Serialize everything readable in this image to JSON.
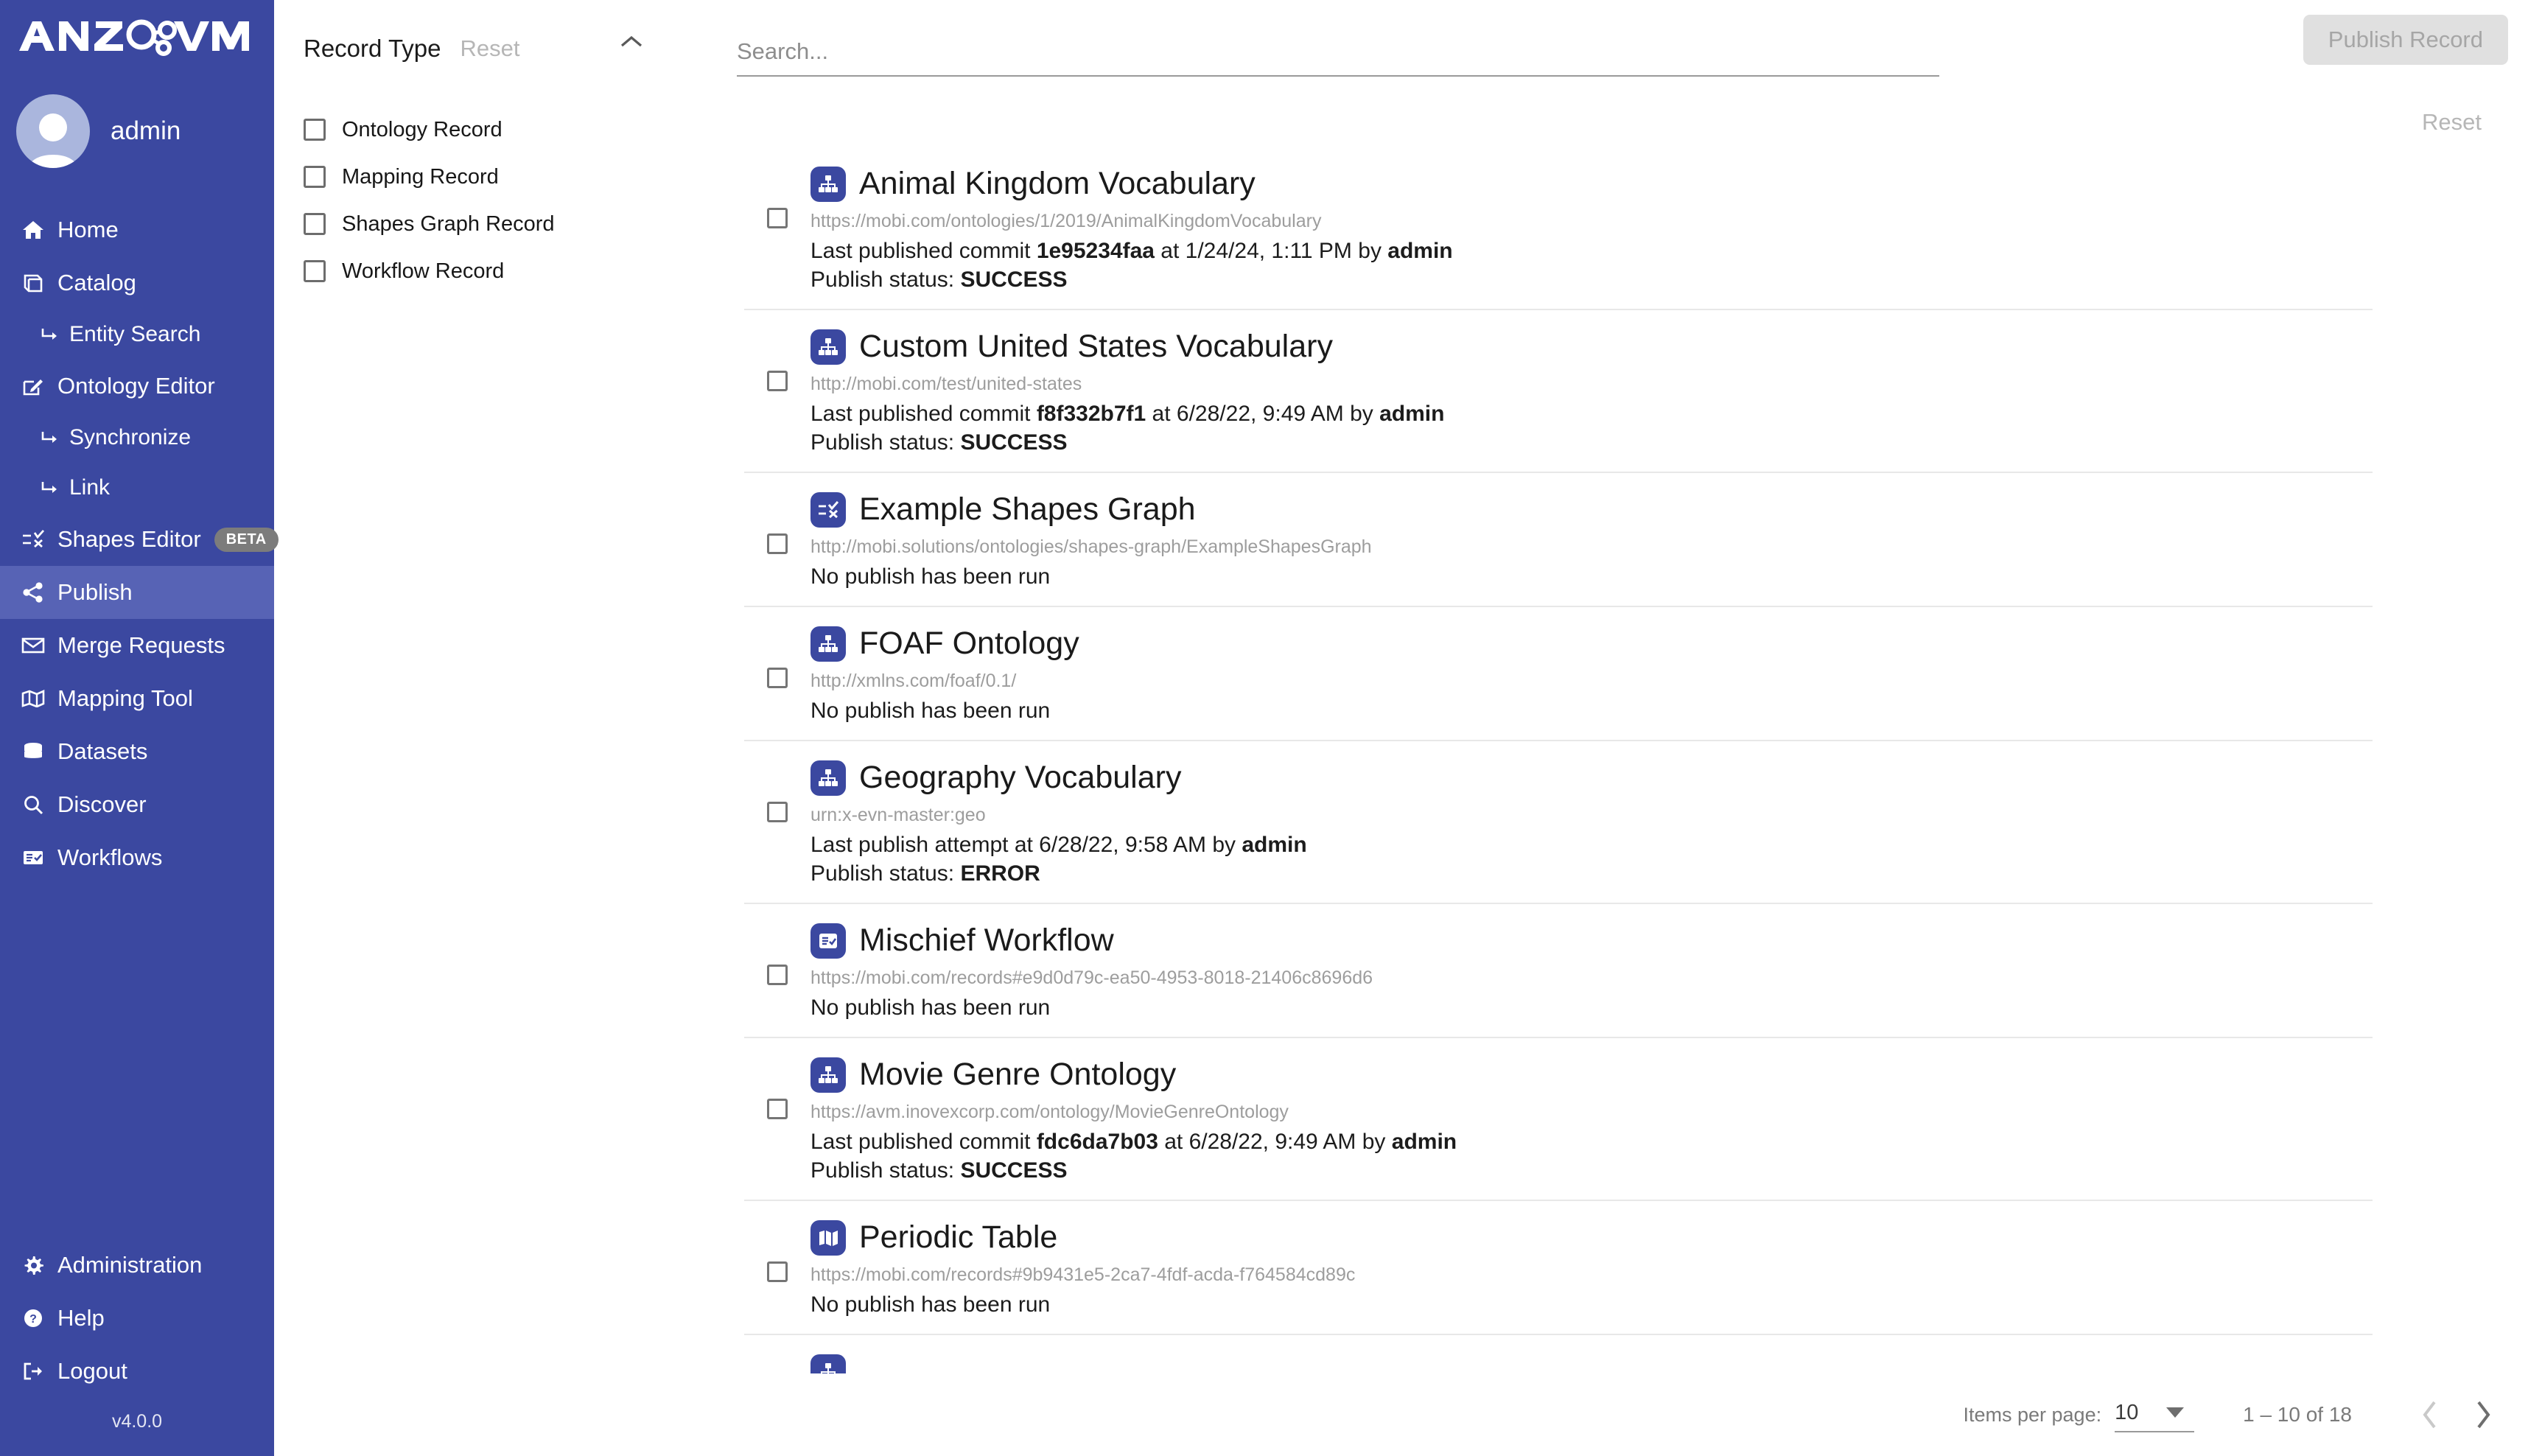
{
  "brand": {
    "logo_text": "ANZOVM",
    "sidebar_color": "#3b48a0",
    "version": "v4.0.0"
  },
  "sidebar": {
    "user": {
      "name": "admin",
      "avatar_icon": "user-avatar-icon"
    },
    "items": [
      {
        "label": "Home",
        "icon": "home-icon",
        "sub": false,
        "active": false
      },
      {
        "label": "Catalog",
        "icon": "book-icon",
        "sub": false,
        "active": false
      },
      {
        "label": "Entity Search",
        "icon": "arrow-subitem-icon",
        "sub": true,
        "active": false
      },
      {
        "label": "Ontology Editor",
        "icon": "edit-square-icon",
        "sub": false,
        "active": false
      },
      {
        "label": "Synchronize",
        "icon": "arrow-subitem-icon",
        "sub": true,
        "active": false
      },
      {
        "label": "Link",
        "icon": "arrow-subitem-icon",
        "sub": true,
        "active": false
      },
      {
        "label": "Shapes Editor",
        "icon": "shapes-icon",
        "sub": false,
        "active": false,
        "badge": "BETA"
      },
      {
        "label": "Publish",
        "icon": "share-icon",
        "sub": false,
        "active": true
      },
      {
        "label": "Merge Requests",
        "icon": "envelope-icon",
        "sub": false,
        "active": false
      },
      {
        "label": "Mapping Tool",
        "icon": "map-icon",
        "sub": false,
        "active": false
      },
      {
        "label": "Datasets",
        "icon": "database-icon",
        "sub": false,
        "active": false
      },
      {
        "label": "Discover",
        "icon": "search-icon",
        "sub": false,
        "active": false
      },
      {
        "label": "Workflows",
        "icon": "workflow-icon",
        "sub": false,
        "active": false
      }
    ],
    "bottom_items": [
      {
        "label": "Administration",
        "icon": "gear-icon"
      },
      {
        "label": "Help",
        "icon": "question-circle-icon"
      },
      {
        "label": "Logout",
        "icon": "logout-icon"
      }
    ]
  },
  "filters": {
    "title": "Record Type",
    "reset_label": "Reset",
    "collapse_icon": "chevron-up-icon",
    "options": [
      {
        "label": "Ontology Record",
        "checked": false
      },
      {
        "label": "Mapping Record",
        "checked": false
      },
      {
        "label": "Shapes Graph Record",
        "checked": false
      },
      {
        "label": "Workflow Record",
        "checked": false
      }
    ]
  },
  "toolbar": {
    "search_placeholder": "Search...",
    "search_value": "",
    "publish_button": "Publish Record",
    "reset_label": "Reset"
  },
  "records": [
    {
      "title": "Animal Kingdom Vocabulary",
      "icon": "ontology-hierarchy-icon",
      "iri": "https://mobi.com/ontologies/1/2019/AnimalKingdomVocabulary",
      "meta_prefix": "Last published commit ",
      "commit": "1e95234faa",
      "meta_mid": " at 1/24/24, 1:11 PM by ",
      "user": "admin",
      "status_label": "Publish status: ",
      "status": "SUCCESS",
      "checked": false
    },
    {
      "title": "Custom United States Vocabulary",
      "icon": "ontology-hierarchy-icon",
      "iri": "http://mobi.com/test/united-states",
      "meta_prefix": "Last published commit ",
      "commit": "f8f332b7f1",
      "meta_mid": " at 6/28/22, 9:49 AM by ",
      "user": "admin",
      "status_label": "Publish status: ",
      "status": "SUCCESS",
      "checked": false
    },
    {
      "title": "Example Shapes Graph",
      "icon": "shapes-graph-icon",
      "iri": "http://mobi.solutions/ontologies/shapes-graph/ExampleShapesGraph",
      "meta_prefix": "No publish has been run",
      "commit": "",
      "meta_mid": "",
      "user": "",
      "status_label": "",
      "status": "",
      "checked": false
    },
    {
      "title": "FOAF Ontology",
      "icon": "ontology-hierarchy-icon",
      "iri": "http://xmlns.com/foaf/0.1/",
      "meta_prefix": "No publish has been run",
      "commit": "",
      "meta_mid": "",
      "user": "",
      "status_label": "",
      "status": "",
      "checked": false
    },
    {
      "title": "Geography Vocabulary",
      "icon": "ontology-hierarchy-icon",
      "iri": "urn:x-evn-master:geo",
      "meta_prefix": "Last publish attempt at 6/28/22, 9:58 AM by ",
      "commit": "",
      "meta_mid": "",
      "user": "admin",
      "status_label": "Publish status: ",
      "status": "ERROR",
      "checked": false
    },
    {
      "title": "Mischief Workflow",
      "icon": "workflow-record-icon",
      "iri": "https://mobi.com/records#e9d0d79c-ea50-4953-8018-21406c8696d6",
      "meta_prefix": "No publish has been run",
      "commit": "",
      "meta_mid": "",
      "user": "",
      "status_label": "",
      "status": "",
      "checked": false
    },
    {
      "title": "Movie Genre Ontology",
      "icon": "ontology-hierarchy-icon",
      "iri": "https://avm.inovexcorp.com/ontology/MovieGenreOntology",
      "meta_prefix": "Last published commit ",
      "commit": "fdc6da7b03",
      "meta_mid": " at 6/28/22, 9:49 AM by ",
      "user": "admin",
      "status_label": "Publish status: ",
      "status": "SUCCESS",
      "checked": false
    },
    {
      "title": "Periodic Table",
      "icon": "mapping-record-icon",
      "iri": "https://mobi.com/records#9b9431e5-2ca7-4fdf-acda-f764584cd89c",
      "meta_prefix": "No publish has been run",
      "commit": "",
      "meta_mid": "",
      "user": "",
      "status_label": "",
      "status": "",
      "checked": false
    }
  ],
  "paginator": {
    "items_per_page_label": "Items per page:",
    "items_per_page_value": "10",
    "range_label": "1 – 10 of 18",
    "prev_icon": "chevron-left-icon",
    "next_icon": "chevron-right-icon",
    "prev_enabled": false,
    "next_enabled": true
  }
}
